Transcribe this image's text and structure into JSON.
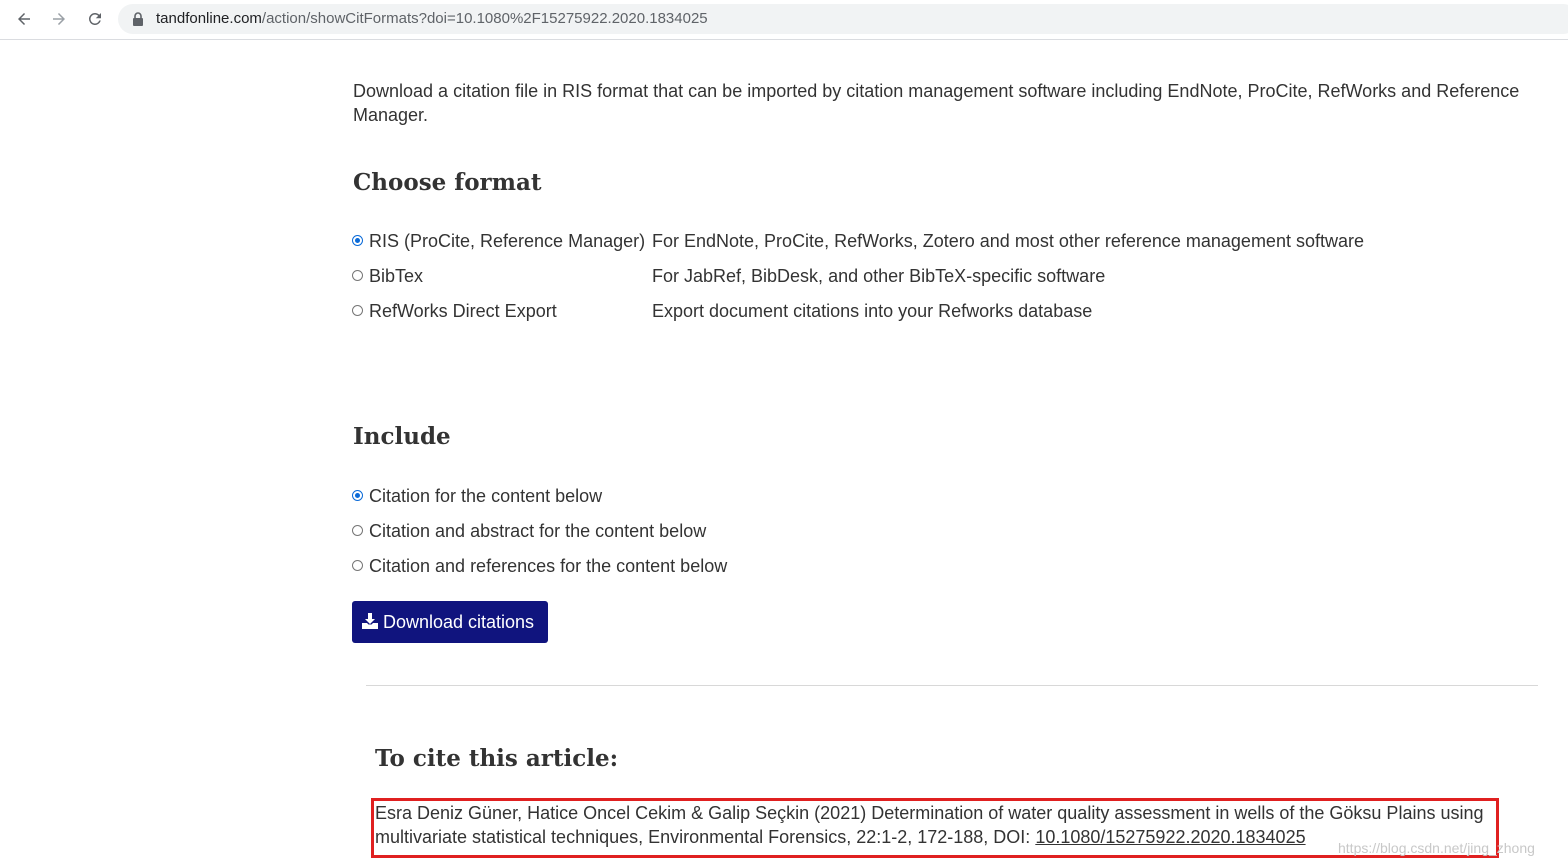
{
  "browser": {
    "url_host": "tandfonline.com",
    "url_path": "/action/showCitFormats?doi=10.1080%2F15275922.2020.1834025"
  },
  "intro_text": "Download a citation file in RIS format that can be imported by citation management software including EndNote, ProCite, RefWorks and Reference Manager.",
  "choose_format": {
    "heading": "Choose format",
    "options": [
      {
        "label": "RIS (ProCite, Reference Manager)",
        "description": "For EndNote, ProCite, RefWorks, Zotero and most other reference management software",
        "checked": true
      },
      {
        "label": "BibTex",
        "description": "For JabRef, BibDesk, and other BibTeX-specific software",
        "checked": false
      },
      {
        "label": "RefWorks Direct Export",
        "description": "Export document citations into your Refworks database",
        "checked": false
      }
    ]
  },
  "include": {
    "heading": "Include",
    "options": [
      {
        "label": "Citation for the content below",
        "checked": true
      },
      {
        "label": "Citation and abstract for the content below",
        "checked": false
      },
      {
        "label": "Citation and references for the content below",
        "checked": false
      }
    ]
  },
  "download_button": {
    "label": "Download citations",
    "icon": "download-icon"
  },
  "cite": {
    "heading": "To cite this article:",
    "text": "Esra Deniz Güner, Hatice Oncel Cekim & Galip Seçkin (2021) Determination of water quality assessment in wells of the Göksu Plains using multivariate statistical techniques, Environmental Forensics, 22:1-2, 172-188, DOI: ",
    "doi": "10.1080/15275922.2020.1834025"
  },
  "watermark": "https://blog.csdn.net/jing_zhong",
  "colors": {
    "button_bg": "#10147e",
    "highlight_border": "#e02020",
    "radio_checked": "#0a6ad8"
  }
}
